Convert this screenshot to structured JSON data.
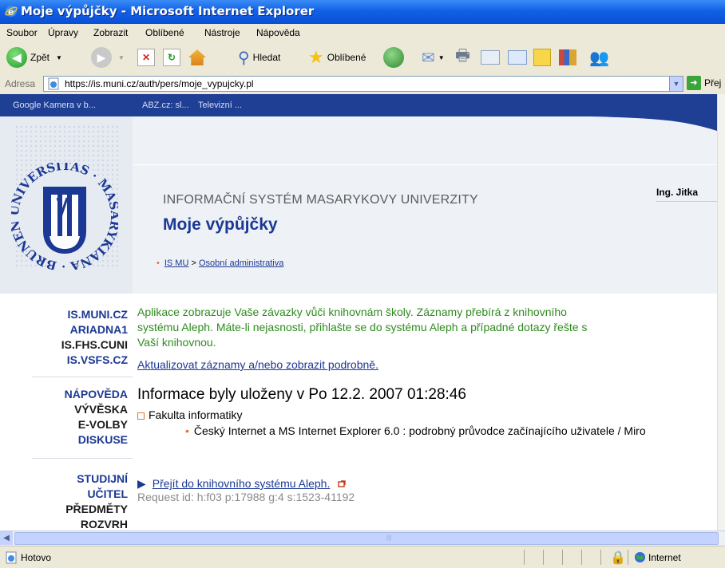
{
  "window": {
    "title": "Moje výpůjčky - Microsoft Internet Explorer"
  },
  "menu": [
    "Soubor",
    "Úpravy",
    "Zobrazit",
    "Oblíbené",
    "Nástroje",
    "Nápověda"
  ],
  "toolbar": {
    "back": "Zpět",
    "search": "Hledat",
    "favorites": "Oblíbené"
  },
  "address": {
    "label": "Adresa",
    "url": "https://is.muni.cz/auth/pers/moje_vypujcky.pl",
    "go": "Přej"
  },
  "links_bar": [
    "Google Kamera v b...",
    "ABZ.cz: sl...",
    "Televizní ..."
  ],
  "header": {
    "site_title": "INFORMAČNÍ SYSTÉM MASARYKOVY UNIVERZITY",
    "page_title": "Moje výpůjčky",
    "user": "Ing. Jitka",
    "breadcrumb": {
      "home": "IS MU",
      "sep": " > ",
      "section": "Osobní administrativa"
    }
  },
  "nav": {
    "group1": [
      "IS.MUNI.CZ",
      "ARIADNA1",
      "IS.FHS.CUNI",
      "IS.VSFS.CZ"
    ],
    "group2": [
      "NÁPOVĚDA",
      "VÝVĚSKA",
      "E-VOLBY",
      "DISKUSE"
    ],
    "group3": [
      "STUDIJNÍ",
      "UČITEL",
      "PŘEDMĚTY",
      "ROZVRH"
    ]
  },
  "content": {
    "info_lines": [
      "Aplikace zobrazuje Vaše závazky vůči knihovnám školy. Záznamy přebírá z knihovního",
      "systému Aleph. Máte-li nejasnosti, přihlašte se do systému Aleph a případné dotazy řešte s",
      "Vaší knihovnou."
    ],
    "update_link": "Aktualizovat záznamy a/nebo zobrazit podrobně.",
    "saved_heading": "Informace byly uloženy v Po 12.2. 2007 01:28:46",
    "faculty": "Fakulta informatiky",
    "book": "Český Internet a MS Internet Explorer 6.0 : podrobný průvodce začínajícího uživatele / Miro",
    "aleph_link": "Přejít do knihovního systému Aleph.",
    "request_id": "Request id: h:f03 p:17988 g:4 s:1523-41192"
  },
  "status": {
    "text": "Hotovo",
    "zone": "Internet"
  },
  "colors": {
    "navy": "#1b3894",
    "green": "#2e8b1e",
    "orange": "#e9732d",
    "titlebar": "#0a4fd6"
  }
}
